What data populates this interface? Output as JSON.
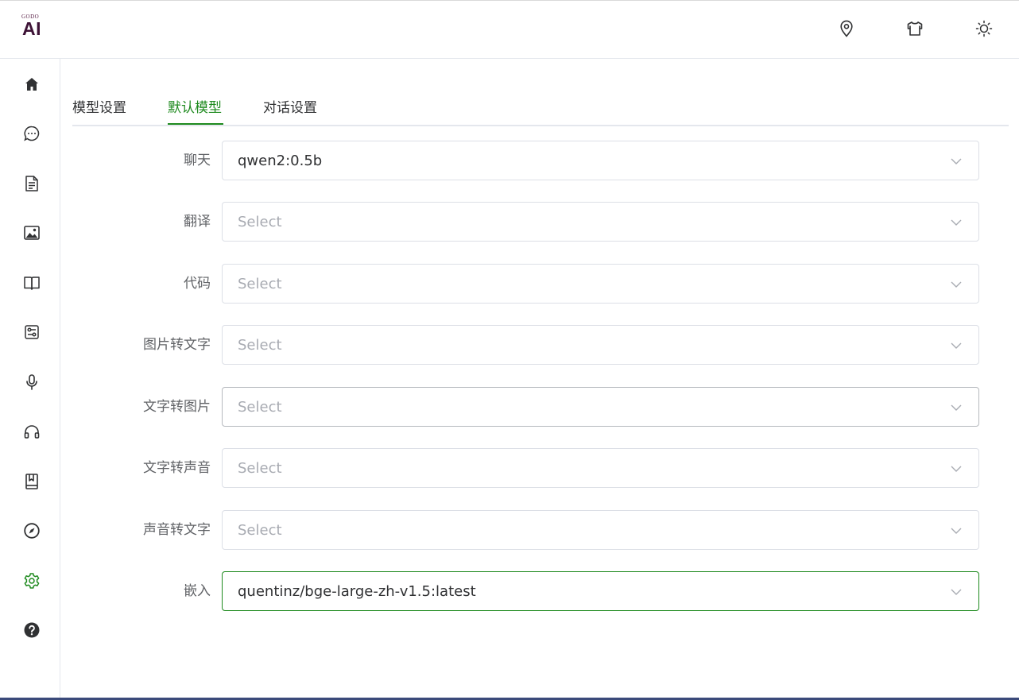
{
  "app": {
    "logo_small": "GODO",
    "logo_big": "AI"
  },
  "topbar": {
    "icons": [
      "location-pin-icon",
      "shirt-icon",
      "sun-icon"
    ]
  },
  "sidebar": {
    "items": [
      {
        "icon": "home-icon",
        "active": false
      },
      {
        "icon": "chat-bubble-icon",
        "active": false
      },
      {
        "icon": "document-icon",
        "active": false
      },
      {
        "icon": "image-icon",
        "active": false
      },
      {
        "icon": "book-open-icon",
        "active": false
      },
      {
        "icon": "sliders-icon",
        "active": false
      },
      {
        "icon": "microphone-icon",
        "active": false
      },
      {
        "icon": "headphones-icon",
        "active": false
      },
      {
        "icon": "bookmark-book-icon",
        "active": false
      },
      {
        "icon": "compass-icon",
        "active": false
      },
      {
        "icon": "gear-icon",
        "active": true
      },
      {
        "icon": "help-circle-icon",
        "active": false
      }
    ],
    "active_color": "#1e8a1e"
  },
  "tabs": [
    {
      "label": "模型设置",
      "active": false
    },
    {
      "label": "默认模型",
      "active": true
    },
    {
      "label": "对话设置",
      "active": false
    }
  ],
  "form": {
    "placeholder": "Select",
    "rows": [
      {
        "label": "聊天",
        "value": "qwen2:0.5b"
      },
      {
        "label": "翻译",
        "value": ""
      },
      {
        "label": "代码",
        "value": ""
      },
      {
        "label": "图片转文字",
        "value": ""
      },
      {
        "label": "文字转图片",
        "value": ""
      },
      {
        "label": "文字转声音",
        "value": ""
      },
      {
        "label": "声音转文字",
        "value": ""
      },
      {
        "label": "嵌入",
        "value": "quentinz/bge-large-zh-v1.5:latest"
      }
    ]
  },
  "colors": {
    "accent": "#1e8a1e",
    "logo": "#3d1236"
  }
}
